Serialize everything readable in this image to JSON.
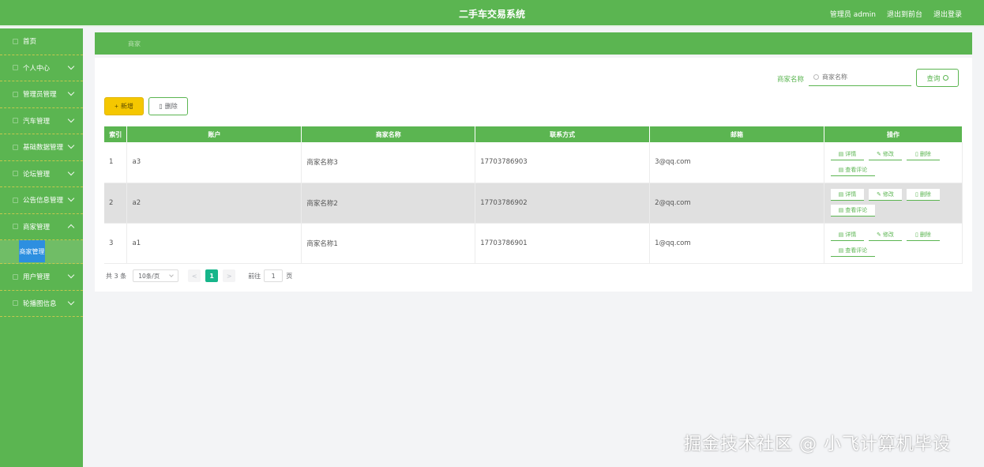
{
  "header": {
    "title": "二手车交易系统",
    "admin_label": "管理员 admin",
    "exit_front": "退出到前台",
    "logout": "退出登录"
  },
  "sidebar": {
    "items": [
      {
        "label": "首页"
      },
      {
        "label": "个人中心"
      },
      {
        "label": "管理员管理"
      },
      {
        "label": "汽车管理"
      },
      {
        "label": "基础数据管理"
      },
      {
        "label": "论坛管理"
      },
      {
        "label": "公告信息管理"
      },
      {
        "label": "商家管理"
      },
      {
        "label": "用户管理"
      },
      {
        "label": "轮播图信息"
      }
    ],
    "active_sub": "商家管理"
  },
  "breadcrumb": {
    "text": "商家"
  },
  "search": {
    "label": "商家名称",
    "placeholder": "商家名称",
    "query_label": "查询"
  },
  "toolbar": {
    "add_label": "新增",
    "delete_label": "删除"
  },
  "table": {
    "headers": [
      "索引",
      "账户",
      "商家名称",
      "联系方式",
      "邮箱",
      "操作"
    ],
    "rows": [
      {
        "index": "1",
        "account": "a3",
        "name": "商家名称3",
        "phone": "17703786903",
        "email": "3@qq.com"
      },
      {
        "index": "2",
        "account": "a2",
        "name": "商家名称2",
        "phone": "17703786902",
        "email": "2@qq.com"
      },
      {
        "index": "3",
        "account": "a1",
        "name": "商家名称1",
        "phone": "17703786901",
        "email": "1@qq.com"
      }
    ],
    "ops": {
      "detail": "详情",
      "edit": "修改",
      "delete": "删除",
      "review": "查看评论"
    }
  },
  "pagination": {
    "total": "共 3 条",
    "page_size": "10条/页",
    "prev": "<",
    "current": "1",
    "next": ">",
    "goto_label": "前往",
    "goto_value": "1",
    "unit": "页"
  },
  "watermark": "掘金技术社区 @ 小飞计算机毕设"
}
